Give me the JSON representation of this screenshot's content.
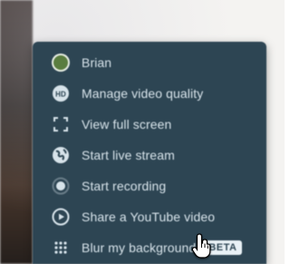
{
  "menu": {
    "items": [
      {
        "label": "Brian",
        "icon": "avatar-icon"
      },
      {
        "label": "Manage video quality",
        "icon": "hd-icon"
      },
      {
        "label": "View full screen",
        "icon": "fullscreen-icon"
      },
      {
        "label": "Start live stream",
        "icon": "globe-icon"
      },
      {
        "label": "Start recording",
        "icon": "record-dot-icon"
      },
      {
        "label": "Share a YouTube video",
        "icon": "play-circle-icon"
      },
      {
        "label": "Blur my background",
        "icon": "blur-grid-icon",
        "badge": "BETA"
      }
    ]
  },
  "colors": {
    "menu_bg": "#2d4553",
    "menu_text": "#d7e3ea",
    "avatar": "#5a7d3f"
  }
}
